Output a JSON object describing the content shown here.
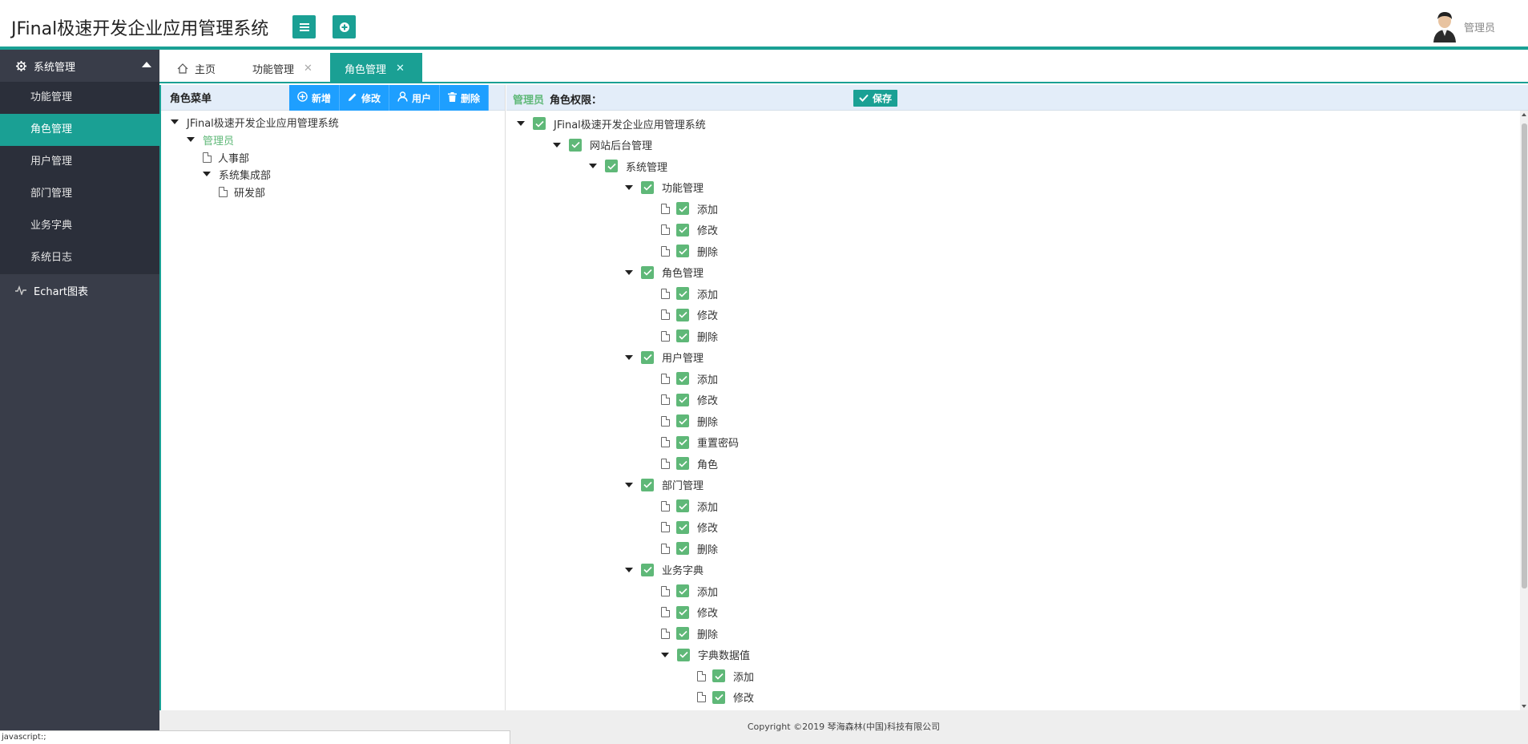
{
  "header": {
    "title": "JFinal极速开发企业应用管理系统",
    "menu_icon": "menu-icon",
    "add_icon": "plus-circle-icon",
    "user": "管理员"
  },
  "sidebar": {
    "groups": [
      {
        "label": "系统管理",
        "icon": "gear-icon",
        "expanded": true
      },
      {
        "label": "Echart图表",
        "icon": "pulse-icon",
        "expanded": false
      }
    ],
    "items": [
      {
        "label": "功能管理"
      },
      {
        "label": "角色管理",
        "active": true
      },
      {
        "label": "用户管理"
      },
      {
        "label": "部门管理"
      },
      {
        "label": "业务字典"
      },
      {
        "label": "系统日志"
      }
    ]
  },
  "tabs": [
    {
      "label": "主页",
      "icon": "home-icon"
    },
    {
      "label": "功能管理",
      "close": "✕"
    },
    {
      "label": "角色管理",
      "close": "✕",
      "active": true
    }
  ],
  "left_panel": {
    "title": "角色菜单",
    "buttons": {
      "add": "新增",
      "edit": "修改",
      "user": "用户",
      "delete": "删除"
    },
    "tree": [
      {
        "label": "JFinal极速开发企业应用管理系统"
      },
      {
        "label": "管理员",
        "selected": true
      },
      {
        "label": "人事部"
      },
      {
        "label": "系统集成部"
      },
      {
        "label": "研发部"
      }
    ]
  },
  "right_panel": {
    "role": "管理员",
    "title": "角色权限：",
    "save": "保存",
    "tree": [
      {
        "label": "JFinal极速开发企业应用管理系统"
      },
      {
        "label": "网站后台管理"
      },
      {
        "label": "系统管理"
      },
      {
        "label": "功能管理"
      },
      {
        "label": "添加"
      },
      {
        "label": "修改"
      },
      {
        "label": "删除"
      },
      {
        "label": "角色管理"
      },
      {
        "label": "添加"
      },
      {
        "label": "修改"
      },
      {
        "label": "删除"
      },
      {
        "label": "用户管理"
      },
      {
        "label": "添加"
      },
      {
        "label": "修改"
      },
      {
        "label": "删除"
      },
      {
        "label": "重置密码"
      },
      {
        "label": "角色"
      },
      {
        "label": "部门管理"
      },
      {
        "label": "添加"
      },
      {
        "label": "修改"
      },
      {
        "label": "删除"
      },
      {
        "label": "业务字典"
      },
      {
        "label": "添加"
      },
      {
        "label": "修改"
      },
      {
        "label": "删除"
      },
      {
        "label": "字典数据值"
      },
      {
        "label": "添加"
      },
      {
        "label": "修改"
      }
    ]
  },
  "footer": {
    "copyright": "Copyright ©2019 琴海森林(中国)科技有限公司"
  },
  "status_bar": {
    "text": "javascript:;"
  },
  "colors": {
    "accent": "#1aa094",
    "blue": "#1e9fff",
    "green": "#5fb878",
    "sidebar": "#393d49"
  }
}
